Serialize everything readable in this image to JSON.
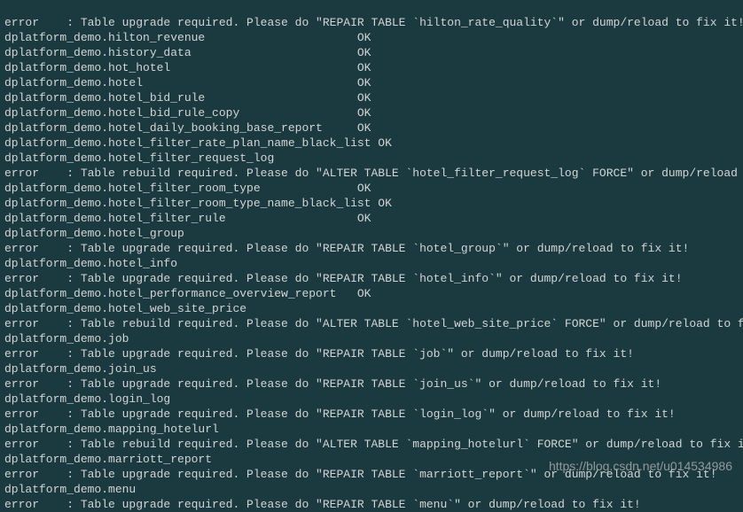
{
  "lines": [
    "error    : Table upgrade required. Please do \"REPAIR TABLE `hilton_rate_quality`\" or dump/reload to fix it!",
    "dplatform_demo.hilton_revenue                      OK",
    "dplatform_demo.history_data                        OK",
    "dplatform_demo.hot_hotel                           OK",
    "dplatform_demo.hotel                               OK",
    "dplatform_demo.hotel_bid_rule                      OK",
    "dplatform_demo.hotel_bid_rule_copy                 OK",
    "dplatform_demo.hotel_daily_booking_base_report     OK",
    "dplatform_demo.hotel_filter_rate_plan_name_black_list OK",
    "dplatform_demo.hotel_filter_request_log",
    "error    : Table rebuild required. Please do \"ALTER TABLE `hotel_filter_request_log` FORCE\" or dump/reload to fix it!",
    "dplatform_demo.hotel_filter_room_type              OK",
    "dplatform_demo.hotel_filter_room_type_name_black_list OK",
    "dplatform_demo.hotel_filter_rule                   OK",
    "dplatform_demo.hotel_group",
    "error    : Table upgrade required. Please do \"REPAIR TABLE `hotel_group`\" or dump/reload to fix it!",
    "dplatform_demo.hotel_info",
    "error    : Table upgrade required. Please do \"REPAIR TABLE `hotel_info`\" or dump/reload to fix it!",
    "dplatform_demo.hotel_performance_overview_report   OK",
    "dplatform_demo.hotel_web_site_price",
    "error    : Table rebuild required. Please do \"ALTER TABLE `hotel_web_site_price` FORCE\" or dump/reload to fix it!",
    "dplatform_demo.job",
    "error    : Table upgrade required. Please do \"REPAIR TABLE `job`\" or dump/reload to fix it!",
    "dplatform_demo.join_us",
    "error    : Table upgrade required. Please do \"REPAIR TABLE `join_us`\" or dump/reload to fix it!",
    "dplatform_demo.login_log",
    "error    : Table upgrade required. Please do \"REPAIR TABLE `login_log`\" or dump/reload to fix it!",
    "dplatform_demo.mapping_hotelurl",
    "error    : Table rebuild required. Please do \"ALTER TABLE `mapping_hotelurl` FORCE\" or dump/reload to fix it!",
    "dplatform_demo.marriott_report",
    "error    : Table upgrade required. Please do \"REPAIR TABLE `marriott_report`\" or dump/reload to fix it!",
    "dplatform_demo.menu",
    "error    : Table upgrade required. Please do \"REPAIR TABLE `menu`\" or dump/reload to fix it!"
  ],
  "watermark": "https://blog.csdn.net/u014534986"
}
